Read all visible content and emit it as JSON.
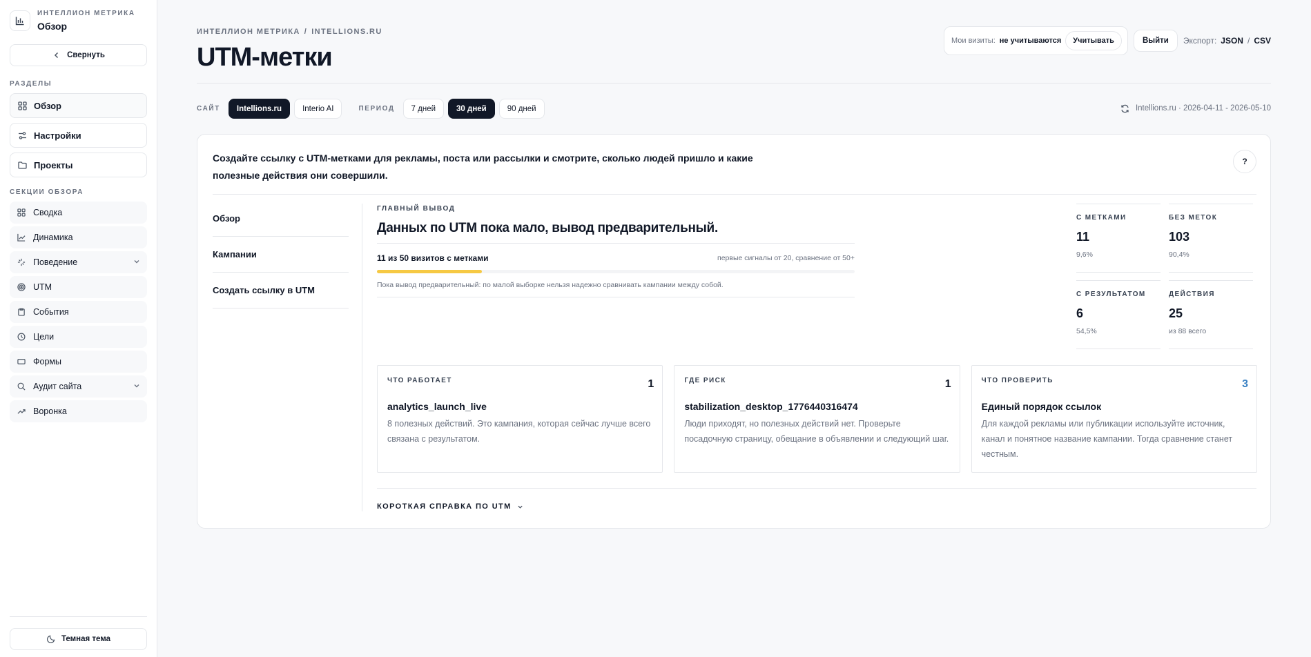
{
  "sidebar": {
    "brand_title": "ИНТЕЛЛИОН МЕТРИКА",
    "brand_sub": "Обзор",
    "collapse_label": "Свернуть",
    "sections_label": "РАЗДЕЛЫ",
    "main_items": [
      {
        "label": "Обзор",
        "icon": "grid-icon"
      },
      {
        "label": "Настройки",
        "icon": "sliders-icon"
      },
      {
        "label": "Проекты",
        "icon": "folder-icon"
      }
    ],
    "overview_label": "СЕКЦИИ ОБЗОРА",
    "sub_items": [
      {
        "label": "Сводка",
        "icon": "grid-icon"
      },
      {
        "label": "Динамика",
        "icon": "chart-line-icon"
      },
      {
        "label": "Поведение",
        "icon": "sparkle-icon"
      },
      {
        "label": "UTM",
        "icon": "target-icon"
      },
      {
        "label": "События",
        "icon": "clipboard-icon"
      },
      {
        "label": "Цели",
        "icon": "goal-icon"
      },
      {
        "label": "Формы",
        "icon": "form-icon"
      },
      {
        "label": "Аудит сайта",
        "icon": "search-icon"
      },
      {
        "label": "Воронка",
        "icon": "trend-icon"
      }
    ],
    "theme_label": "Темная тема"
  },
  "header": {
    "breadcrumb_1": "ИНТЕЛЛИОН МЕТРИКА",
    "breadcrumb_sep": "/",
    "breadcrumb_2": "INTELLIONS.RU",
    "title": "UTM-метки",
    "visits_label": "Мои визиты:",
    "visits_value": "не учитываются",
    "count_button": "Учитывать",
    "logout": "Выйти",
    "export_label": "Экспорт:",
    "export_json": "JSON",
    "export_sep": "/",
    "export_csv": "CSV"
  },
  "filters": {
    "site_label": "САЙТ",
    "sites": [
      "Intellions.ru",
      "Interio AI"
    ],
    "period_label": "ПЕРИОД",
    "periods": [
      "7 дней",
      "30 дней",
      "90 дней"
    ],
    "range": "Intellions.ru · 2026-04-11 - 2026-05-10"
  },
  "card": {
    "intro": "Создайте ссылку с UTM-метками для рекламы, поста или рассылки и смотрите, сколько людей пришло и какие полезные действия они совершили.",
    "help": "?",
    "subnav": [
      "Обзор",
      "Кампании",
      "Создать ссылку в UTM"
    ],
    "summary": {
      "kicker": "ГЛАВНЫЙ ВЫВОД",
      "title": "Данных по UTM пока мало, вывод предварительный.",
      "progress_label": "11 из 50 визитов с метками",
      "progress_hint": "первые сигналы от 20, сравнение от 50+",
      "progress_fraction": 0.22,
      "note": "Пока вывод предварительный: по малой выборке нельзя надежно сравнивать кампании между собой."
    },
    "stats": [
      {
        "label": "С МЕТКАМИ",
        "value": "11",
        "sub": "9,6%"
      },
      {
        "label": "БЕЗ МЕТОК",
        "value": "103",
        "sub": "90,4%"
      },
      {
        "label": "С РЕЗУЛЬТАТОМ",
        "value": "6",
        "sub": "54,5%"
      },
      {
        "label": "ДЕЙСТВИЯ",
        "value": "25",
        "sub": "из 88 всего"
      }
    ],
    "insights": [
      {
        "kicker": "ЧТО РАБОТАЕТ",
        "count": "1",
        "title": "analytics_launch_live",
        "text": "8 полезных действий. Это кампания, которая сейчас лучше всего связана с результатом."
      },
      {
        "kicker": "ГДЕ РИСК",
        "count": "1",
        "title": "stabilization_desktop_1776440316474",
        "text": "Люди приходят, но полезных действий нет. Проверьте посадочную страницу, обещание в объявлении и следующий шаг."
      },
      {
        "kicker": "ЧТО ПРОВЕРИТЬ",
        "count": "3",
        "title": "Единый порядок ссылок",
        "text": "Для каждой рекламы или публикации используйте источник, канал и понятное название кампании. Тогда сравнение станет честным."
      }
    ],
    "reference": "КОРОТКАЯ СПРАВКА ПО UTM",
    "accent_color": "#3b82c4",
    "progress_color": "#f6c944"
  }
}
